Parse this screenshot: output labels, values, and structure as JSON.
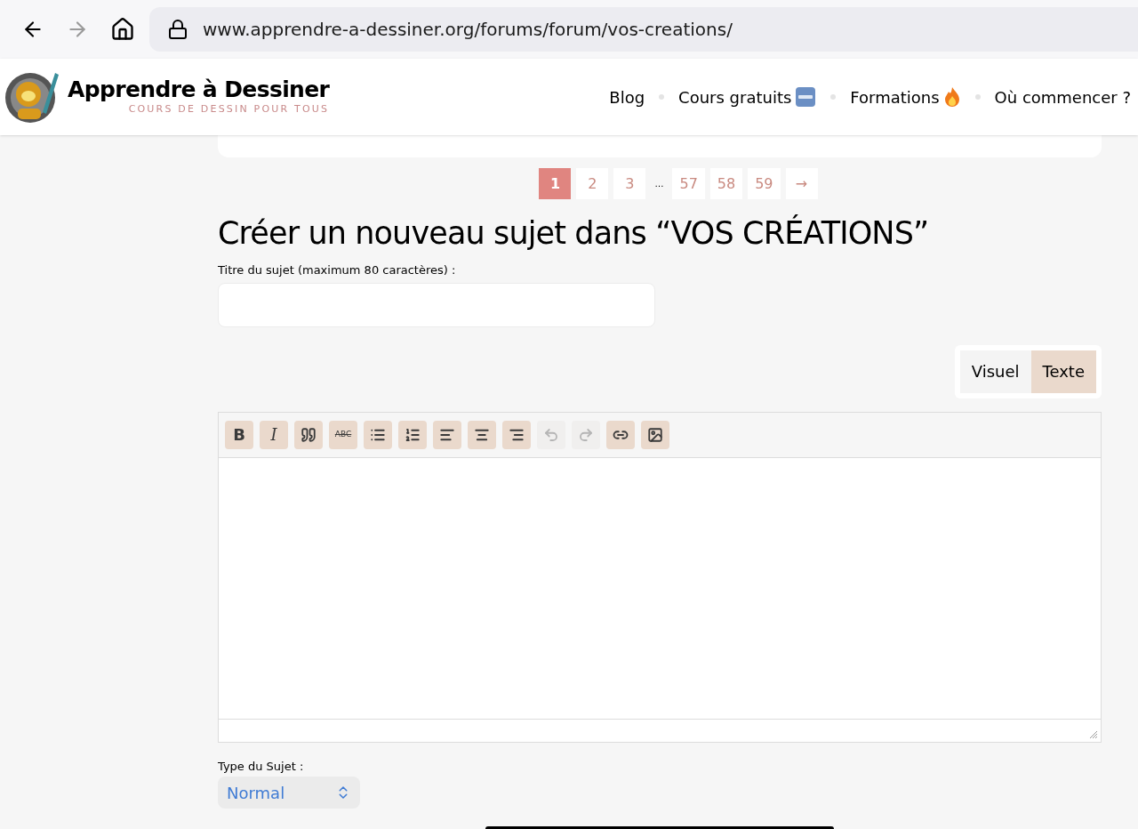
{
  "browser": {
    "url": "www.apprendre-a-dessiner.org/forums/forum/vos-creations/"
  },
  "site": {
    "name": "Apprendre à Dessiner",
    "tagline": "COURS DE DESSIN POUR TOUS"
  },
  "nav": [
    {
      "label": "Blog",
      "kind": "plain"
    },
    {
      "label": "Cours gratuits",
      "kind": "new"
    },
    {
      "label": "Formations",
      "kind": "fire"
    },
    {
      "label": "Où commencer ?",
      "kind": "plain"
    }
  ],
  "pagination": [
    {
      "label": "1",
      "kind": "page",
      "selected": true
    },
    {
      "label": "2",
      "kind": "page",
      "selected": false
    },
    {
      "label": "3",
      "kind": "page",
      "selected": false
    },
    {
      "label": "…",
      "kind": "gap"
    },
    {
      "label": "57",
      "kind": "page",
      "selected": false
    },
    {
      "label": "58",
      "kind": "page",
      "selected": false
    },
    {
      "label": "59",
      "kind": "page",
      "selected": false
    },
    {
      "label": "→",
      "kind": "page",
      "selected": false
    }
  ],
  "heading": "Créer un nouveau sujet dans “VOS CRÉATIONS”",
  "title_field": {
    "label": "Titre du sujet (maximum 80 caractères) :"
  },
  "editor_tabs": [
    {
      "label": "Visuel",
      "selected": false
    },
    {
      "label": "Texte",
      "selected": true
    }
  ],
  "toolbar": [
    {
      "kind": "bold",
      "label": "B",
      "disabled": false
    },
    {
      "kind": "italic",
      "label": "I",
      "disabled": false
    },
    {
      "kind": "quote",
      "disabled": false
    },
    {
      "kind": "strike",
      "label": "ABC",
      "disabled": false
    },
    {
      "kind": "ul",
      "disabled": false
    },
    {
      "kind": "ol",
      "disabled": false
    },
    {
      "kind": "left",
      "disabled": false
    },
    {
      "kind": "center",
      "disabled": false
    },
    {
      "kind": "right",
      "disabled": false
    },
    {
      "kind": "undo",
      "disabled": true
    },
    {
      "kind": "redo",
      "disabled": true
    },
    {
      "kind": "link",
      "disabled": false
    },
    {
      "kind": "image",
      "disabled": false
    }
  ],
  "topic_type": {
    "label": "Type du Sujet :",
    "value": "Normal"
  }
}
